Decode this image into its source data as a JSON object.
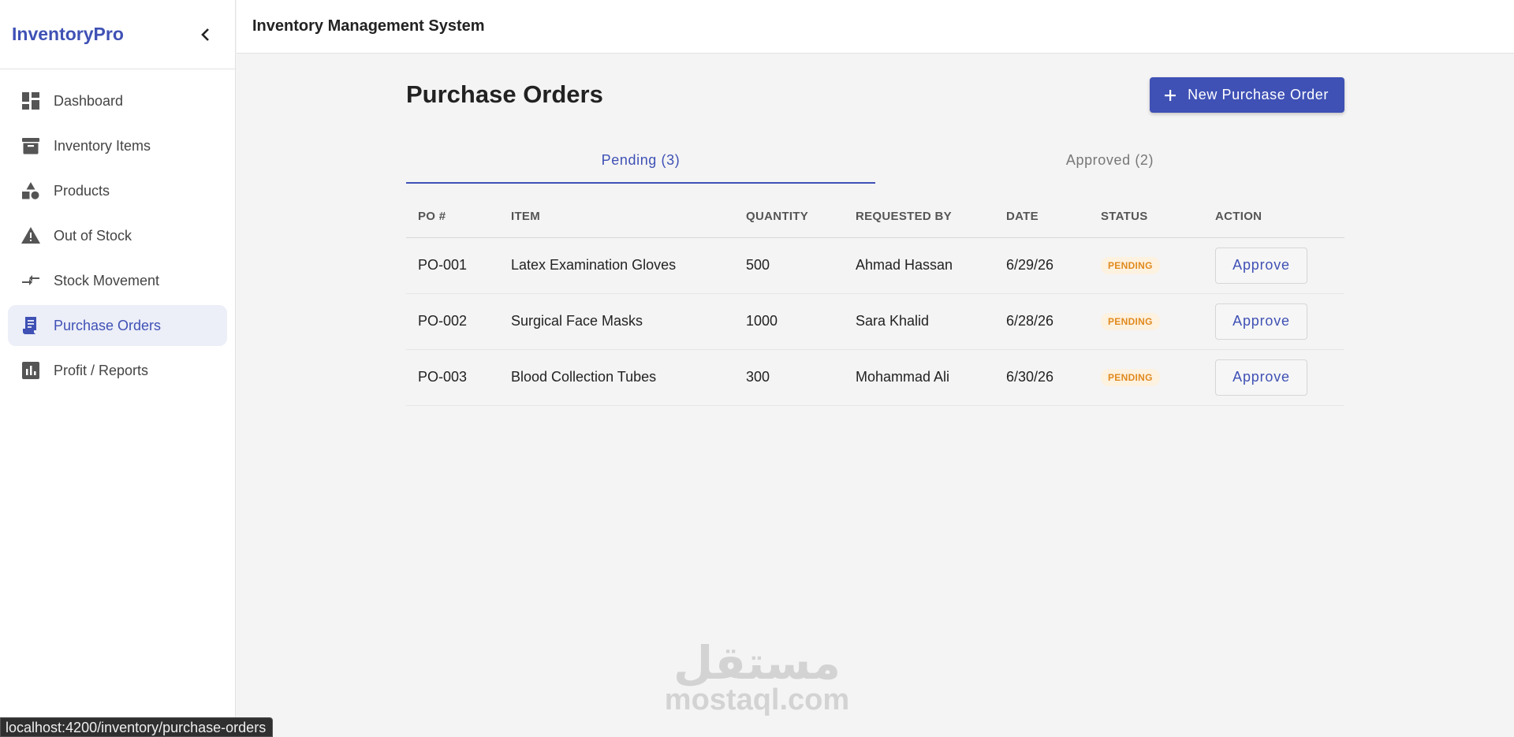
{
  "brand": {
    "name": "InventoryPro"
  },
  "sidebar": {
    "items": [
      {
        "label": "Dashboard",
        "icon": "dashboard-icon"
      },
      {
        "label": "Inventory Items",
        "icon": "archive-icon"
      },
      {
        "label": "Products",
        "icon": "category-icon"
      },
      {
        "label": "Out of Stock",
        "icon": "warning-icon"
      },
      {
        "label": "Stock Movement",
        "icon": "compare-arrows-icon"
      },
      {
        "label": "Purchase Orders",
        "icon": "receipt-icon",
        "active": true
      },
      {
        "label": "Profit / Reports",
        "icon": "bar-chart-icon"
      }
    ]
  },
  "header": {
    "title": "Inventory Management System"
  },
  "page": {
    "title": "Purchase Orders",
    "new_button": "New Purchase Order"
  },
  "tabs": [
    {
      "label": "Pending (3)",
      "active": true
    },
    {
      "label": "Approved (2)",
      "active": false
    }
  ],
  "table": {
    "columns": [
      "PO #",
      "ITEM",
      "QUANTITY",
      "REQUESTED BY",
      "DATE",
      "STATUS",
      "ACTION"
    ],
    "rows": [
      {
        "po": "PO-001",
        "item": "Latex Examination Gloves",
        "quantity": "500",
        "requested_by": "Ahmad Hassan",
        "date": "6/29/26",
        "status": "PENDING",
        "action": "Approve"
      },
      {
        "po": "PO-002",
        "item": "Surgical Face Masks",
        "quantity": "1000",
        "requested_by": "Sara Khalid",
        "date": "6/28/26",
        "status": "PENDING",
        "action": "Approve"
      },
      {
        "po": "PO-003",
        "item": "Blood Collection Tubes",
        "quantity": "300",
        "requested_by": "Mohammad Ali",
        "date": "6/30/26",
        "status": "PENDING",
        "action": "Approve"
      }
    ]
  },
  "watermark": {
    "arabic": "مستقل",
    "latin": "mostaql.com"
  },
  "status_url": "localhost:4200/inventory/purchase-orders",
  "colors": {
    "accent": "#3f51b5",
    "pending_badge_text": "#e08a1e",
    "pending_badge_bg": "#fdf1e0"
  }
}
